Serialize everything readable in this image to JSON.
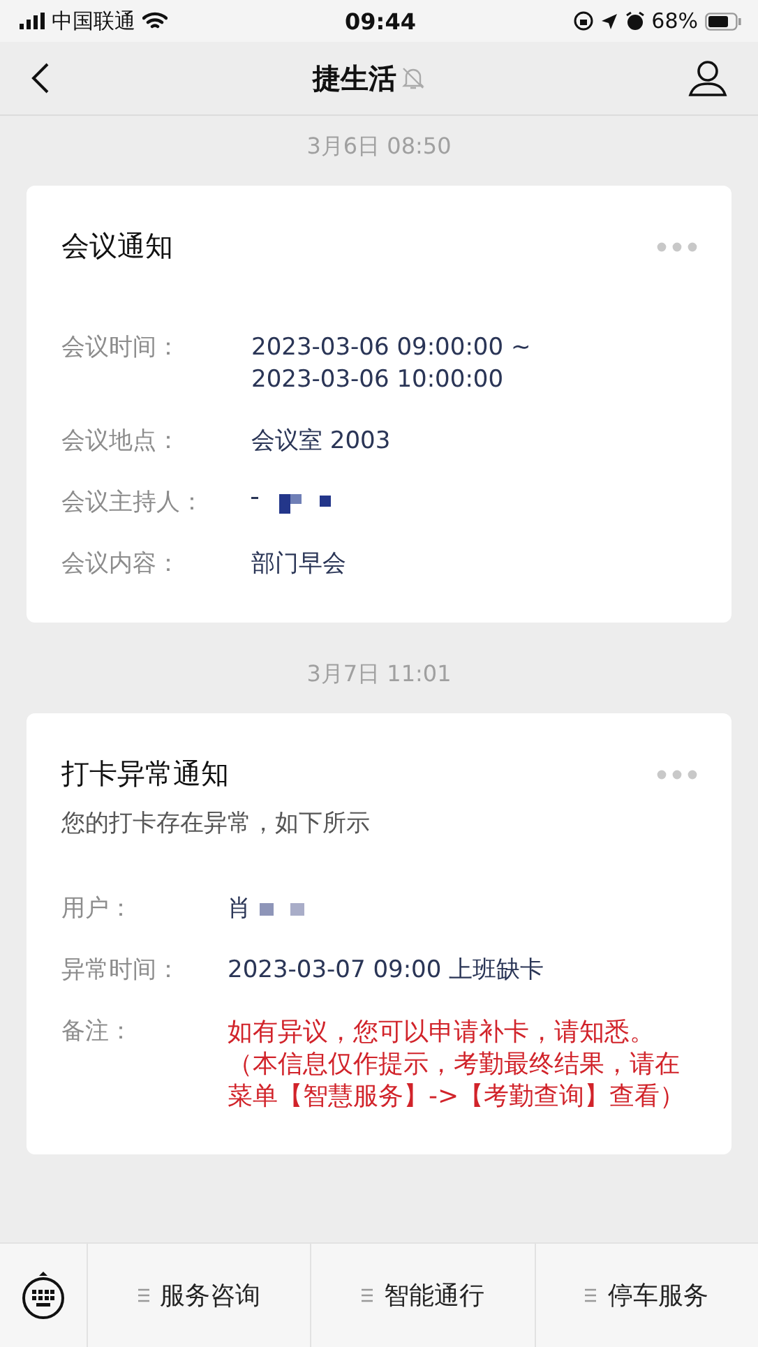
{
  "status_bar": {
    "carrier": "中国联通",
    "time": "09:44",
    "battery": "68%"
  },
  "nav": {
    "title": "捷生活",
    "muted": true
  },
  "messages": [
    {
      "timestamp": "3月6日 08:50",
      "title": "会议通知",
      "rows": [
        {
          "label": "会议时间：",
          "kind": "text",
          "value": "2023-03-06 09:00:00 ~\n2023-03-06 10:00:00"
        },
        {
          "label": "会议地点：",
          "kind": "text",
          "value": "会议室 2003"
        },
        {
          "label": "会议主持人：",
          "kind": "masked",
          "value": ""
        },
        {
          "label": "会议内容：",
          "kind": "text",
          "value": "部门早会"
        }
      ]
    },
    {
      "timestamp": "3月7日 11:01",
      "title": "打卡异常通知",
      "subtitle": "您的打卡存在异常，如下所示",
      "rows": [
        {
          "label": "用户：",
          "kind": "masked",
          "value": "肖"
        },
        {
          "label": "异常时间：",
          "kind": "text",
          "value": "2023-03-07 09:00 上班缺卡"
        },
        {
          "label": "备注：",
          "kind": "warning",
          "value": "如有异议，您可以申请补卡，请知悉。（本信息仅作提示，考勤最终结果，请在菜单【智慧服务】->【考勤查询】查看）"
        }
      ]
    }
  ],
  "menu": [
    "服务咨询",
    "智能通行",
    "停车服务"
  ]
}
